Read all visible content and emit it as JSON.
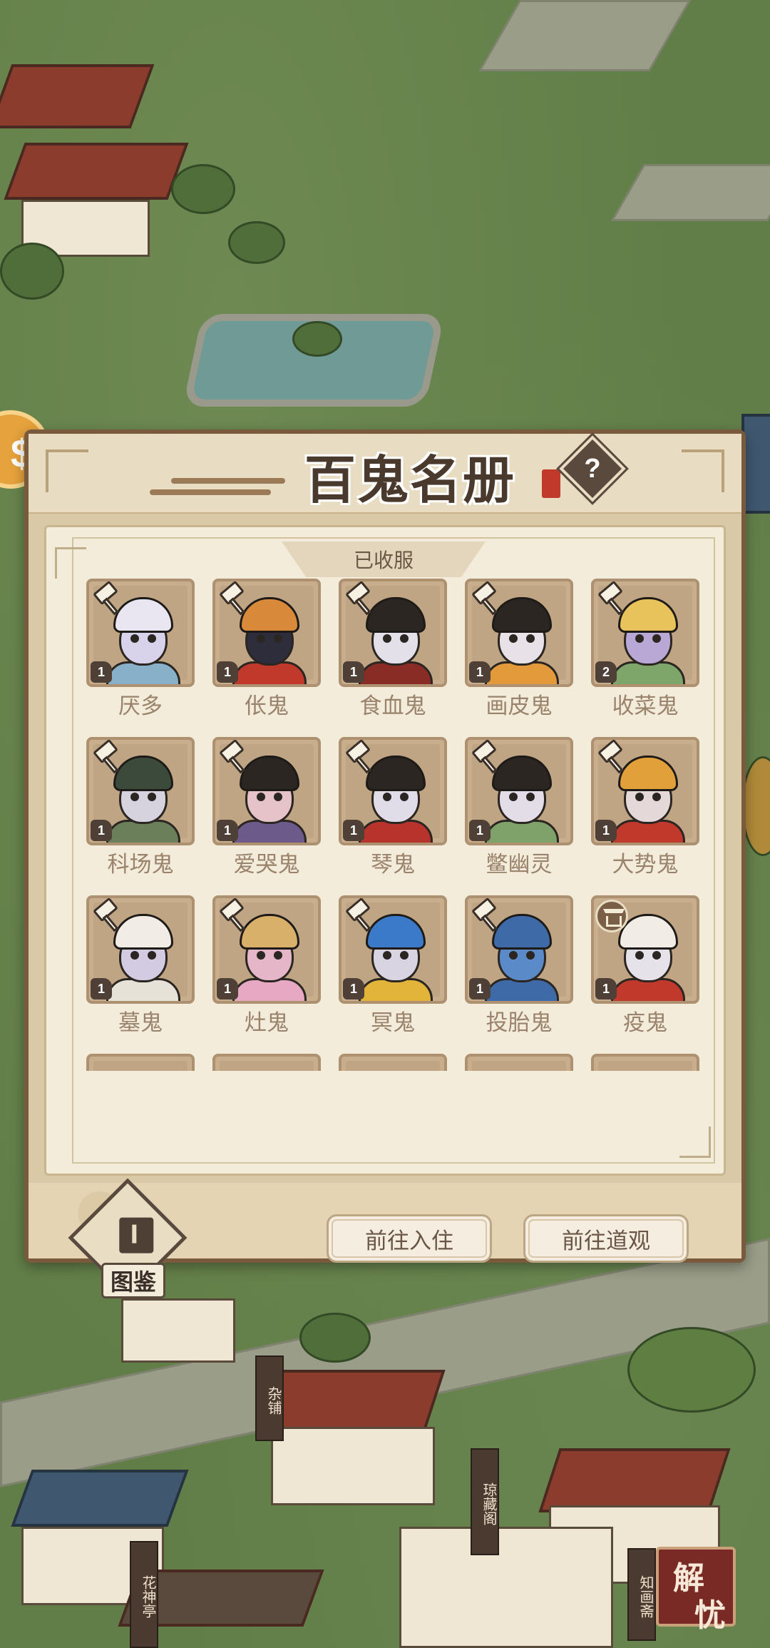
{
  "dialog": {
    "title": "百鬼名册",
    "help_label": "?",
    "section_label": "已收服"
  },
  "ghosts": [
    {
      "name": "厌多",
      "level": "1",
      "badge": "hammer-icon",
      "hair": "#e9e6f2",
      "skin": "#d8d3ea",
      "robe": "#88b0c8"
    },
    {
      "name": "伥鬼",
      "level": "1",
      "badge": "hammer-icon",
      "hair": "#d88a3a",
      "skin": "#2d2d3c",
      "robe": "#c0392b"
    },
    {
      "name": "食血鬼",
      "level": "1",
      "badge": "hammer-icon",
      "hair": "#2b2622",
      "skin": "#e3e0ea",
      "robe": "#8a2c26"
    },
    {
      "name": "画皮鬼",
      "level": "1",
      "badge": "hammer-icon",
      "hair": "#2b2622",
      "skin": "#e8e2e8",
      "robe": "#e39a3a"
    },
    {
      "name": "收菜鬼",
      "level": "2",
      "badge": "hammer-icon",
      "hair": "#e8c25a",
      "skin": "#b9a7d6",
      "robe": "#7fa66a"
    },
    {
      "name": "科场鬼",
      "level": "1",
      "badge": "hammer-icon",
      "hair": "#3b4a3a",
      "skin": "#d6d3de",
      "robe": "#6a7f5a"
    },
    {
      "name": "爱哭鬼",
      "level": "1",
      "badge": "hammer-icon",
      "hair": "#2b2622",
      "skin": "#e6c3c8",
      "robe": "#6c5a8a"
    },
    {
      "name": "琴鬼",
      "level": "1",
      "badge": "hammer-icon",
      "hair": "#2b2622",
      "skin": "#e1dde8",
      "robe": "#b8332c"
    },
    {
      "name": "鳖幽灵",
      "level": "1",
      "badge": "hammer-icon",
      "hair": "#2b2622",
      "skin": "#e3dde8",
      "robe": "#7fa26a"
    },
    {
      "name": "大势鬼",
      "level": "1",
      "badge": "hammer-icon",
      "hair": "#e2a03a",
      "skin": "#e4d8d8",
      "robe": "#c0392b"
    },
    {
      "name": "墓鬼",
      "level": "1",
      "badge": "hammer-icon",
      "hair": "#f1ede6",
      "skin": "#d2cbe2",
      "robe": "#e7e2d8"
    },
    {
      "name": "灶鬼",
      "level": "1",
      "badge": "hammer-icon",
      "hair": "#d8b06a",
      "skin": "#e4b6c8",
      "robe": "#e6a8c2"
    },
    {
      "name": "冥鬼",
      "level": "1",
      "badge": "hammer-icon",
      "hair": "#3a7ac8",
      "skin": "#d8d4e2",
      "robe": "#e2b43a"
    },
    {
      "name": "投胎鬼",
      "level": "1",
      "badge": "hammer-icon",
      "hair": "#3e6aa8",
      "skin": "#5a8ac8",
      "robe": "#3e6aa8"
    },
    {
      "name": "疫鬼",
      "level": "1",
      "badge": "temple-icon",
      "hair": "#f1ede6",
      "skin": "#e6e2ea",
      "robe": "#c0392b"
    },
    {
      "name": "",
      "level": "",
      "badge": "",
      "hair": "#2b2622",
      "skin": "#d6d2e2",
      "robe": "#3e4a6a"
    },
    {
      "name": "",
      "level": "",
      "badge": "",
      "hair": "#3a3f4a",
      "skin": "#e0dde6",
      "robe": "#4a4a5a"
    },
    {
      "name": "",
      "level": "",
      "badge": "",
      "hair": "#3a2e2a",
      "skin": "#c7b2c8",
      "robe": "#6a4a5a"
    },
    {
      "name": "",
      "level": "",
      "badge": "",
      "hair": "#e2a36a",
      "skin": "#f1e2cc",
      "robe": "#c0392b"
    },
    {
      "name": "",
      "level": "",
      "badge": "",
      "hair": "#2b2622",
      "skin": "#e6e2e8",
      "robe": "#2b2622"
    }
  ],
  "footer": {
    "tujian_label": "图鉴",
    "move_in_button": "前往入住",
    "go_temple_button": "前往道观"
  },
  "corner": {
    "jieyou_char1": "解",
    "jieyou_char2": "忧"
  },
  "signs": {
    "shop1": "杂铺",
    "shop2": "琼藏阁",
    "shop3": "花神亭",
    "shop4": "知画斋"
  }
}
